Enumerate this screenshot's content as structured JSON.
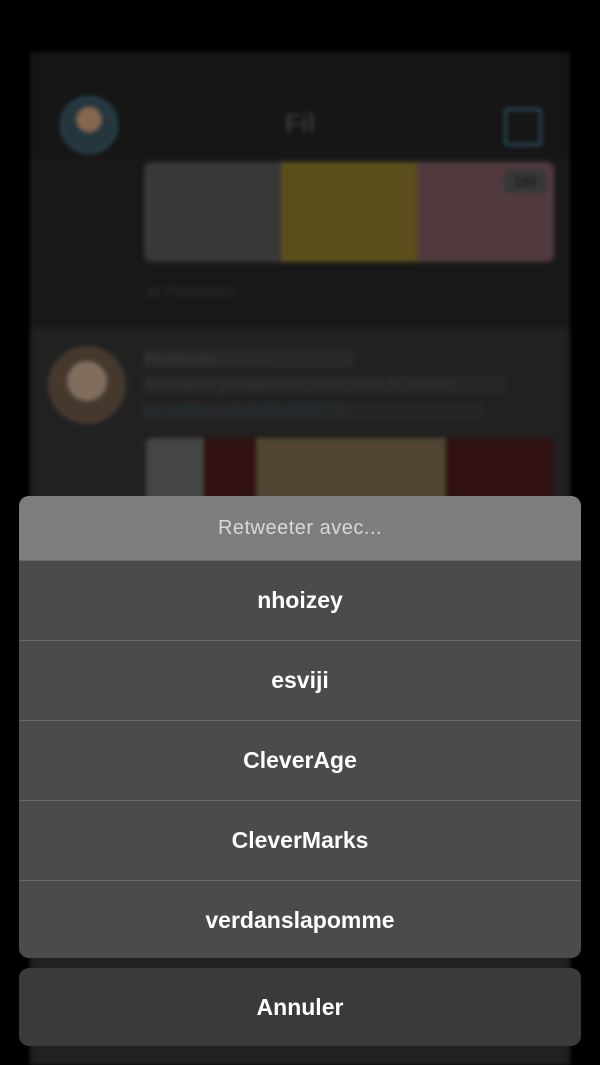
{
  "background": {
    "title": "Fil",
    "tweet1": {
      "retweeted_by": "Padawan",
      "badge": "193"
    },
    "tweet2": {
      "author": "Padawan",
      "handle": "@pdwn",
      "text": "Amusante juxtaposition dans mon fil Twitter",
      "link": "pic.twitter.com/LdTxdYST7X"
    }
  },
  "action_sheet": {
    "title": "Retweeter avec...",
    "options": [
      "nhoizey",
      "esviji",
      "CleverAge",
      "CleverMarks",
      "verdanslapomme"
    ],
    "cancel_label": "Annuler"
  }
}
